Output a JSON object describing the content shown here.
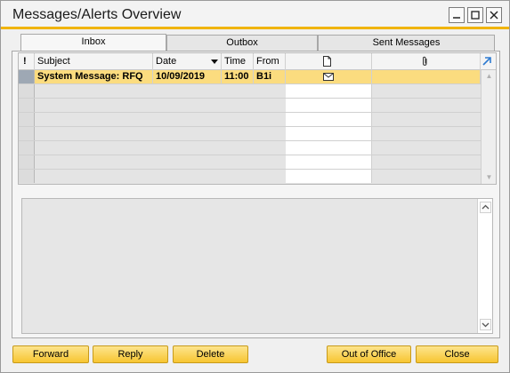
{
  "window": {
    "title": "Messages/Alerts Overview",
    "controls": {
      "minimize": "—",
      "maximize": "☐",
      "close": "✕"
    }
  },
  "tabs": [
    {
      "label": "Inbox",
      "active": true
    },
    {
      "label": "Outbox",
      "active": false
    },
    {
      "label": "Sent Messages",
      "active": false
    }
  ],
  "grid": {
    "columns": {
      "priority": "!",
      "subject": "Subject",
      "date": "Date",
      "time": "Time",
      "from": "From",
      "document_icon": "document-icon",
      "attachment_icon": "paperclip-icon",
      "expand_icon": "expand-arrow-icon"
    },
    "sort_indicator": "sort-descending-icon",
    "rows": [
      {
        "subject": "System Message: RFQ",
        "date": "10/09/2019",
        "time": "11:00",
        "from": "B1i",
        "doc_icon": "envelope-icon",
        "selected": true
      }
    ]
  },
  "preview": {
    "text": ""
  },
  "buttons": {
    "forward": "Forward",
    "reply": "Reply",
    "delete": "Delete",
    "out_of_office": "Out of Office",
    "close": "Close"
  },
  "colors": {
    "accent": "#f0b400",
    "selected_row": "#fbdc7f",
    "button_fill": "#f7c531"
  }
}
